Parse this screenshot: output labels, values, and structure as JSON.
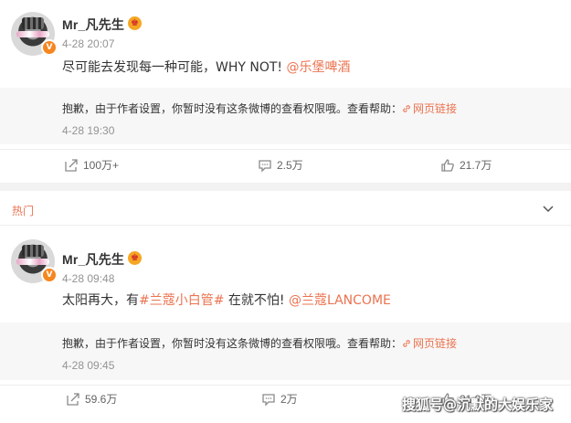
{
  "post1": {
    "author": "Mr_凡先生",
    "time": "4-28 20:07",
    "text_prefix": "尽可能去发现每一种可能，WHY NOT! ",
    "mention": "@乐堡啤酒",
    "repost_notice": "抱歉，由于作者设置，你暂时没有这条微博的查看权限哦。查看帮助：",
    "help_link": "网页链接",
    "repost_time": "4-28 19:30",
    "actions": {
      "share": "100万+",
      "comment": "2.5万",
      "like": "21.7万"
    }
  },
  "section": {
    "label": "热门"
  },
  "post2": {
    "author": "Mr_凡先生",
    "time": "4-28 09:48",
    "text_prefix": "太阳再大，有",
    "hashtag": "#兰蔻小白管#",
    "text_middle": " 在就不怕! ",
    "mention": "@兰蔻LANCOME",
    "repost_notice": "抱歉，由于作者设置，你暂时没有这条微博的查看权限哦。查看帮助：",
    "help_link": "网页链接",
    "repost_time": "4-28 09:45",
    "actions": {
      "share": "59.6万",
      "comment": "2万",
      "like": "21.9万"
    }
  },
  "watermark": "搜狐号@沉默的大娱乐家",
  "colors": {
    "accent": "#eb7350",
    "muted": "#939393",
    "panel": "#f7f7f7"
  },
  "icons": [
    "verified-v-icon",
    "crown-badge-icon",
    "link-icon",
    "share-icon",
    "comment-icon",
    "like-icon",
    "chevron-down-icon"
  ]
}
